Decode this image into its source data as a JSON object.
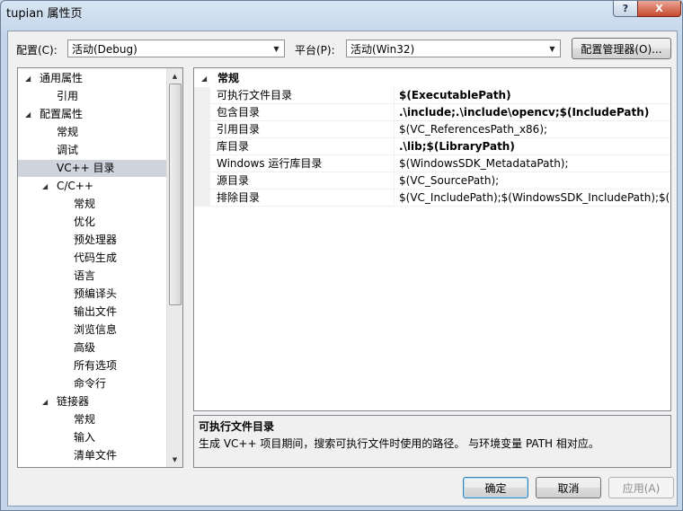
{
  "window": {
    "title": "tupian 属性页",
    "help_label": "?",
    "close_label": "X"
  },
  "config": {
    "label": "配置(C):",
    "value": "活动(Debug)",
    "platform_label": "平台(P):",
    "platform_value": "活动(Win32)",
    "manager_button": "配置管理器(O)..."
  },
  "tree": {
    "items": [
      {
        "label": "通用属性",
        "level": 0,
        "expanded": true
      },
      {
        "label": "引用",
        "level": 1
      },
      {
        "label": "配置属性",
        "level": 0,
        "expanded": true
      },
      {
        "label": "常规",
        "level": 1
      },
      {
        "label": "调试",
        "level": 1
      },
      {
        "label": "VC++ 目录",
        "level": 1,
        "selected": true
      },
      {
        "label": "C/C++",
        "level": 1,
        "expanded": true
      },
      {
        "label": "常规",
        "level": 2
      },
      {
        "label": "优化",
        "level": 2
      },
      {
        "label": "预处理器",
        "level": 2
      },
      {
        "label": "代码生成",
        "level": 2
      },
      {
        "label": "语言",
        "level": 2
      },
      {
        "label": "预编译头",
        "level": 2
      },
      {
        "label": "输出文件",
        "level": 2
      },
      {
        "label": "浏览信息",
        "level": 2
      },
      {
        "label": "高级",
        "level": 2
      },
      {
        "label": "所有选项",
        "level": 2
      },
      {
        "label": "命令行",
        "level": 2
      },
      {
        "label": "链接器",
        "level": 1,
        "expanded": true
      },
      {
        "label": "常规",
        "level": 2
      },
      {
        "label": "输入",
        "level": 2
      },
      {
        "label": "清单文件",
        "level": 2
      }
    ]
  },
  "grid": {
    "category": "常规",
    "rows": [
      {
        "name": "可执行文件目录",
        "value": "$(ExecutablePath)",
        "bold": true
      },
      {
        "name": "包含目录",
        "value": ".\\include;.\\include\\opencv;$(IncludePath)",
        "bold": true
      },
      {
        "name": "引用目录",
        "value": "$(VC_ReferencesPath_x86);",
        "bold": false
      },
      {
        "name": "库目录",
        "value": ".\\lib;$(LibraryPath)",
        "bold": true
      },
      {
        "name": "Windows 运行库目录",
        "value": "$(WindowsSDK_MetadataPath);",
        "bold": false
      },
      {
        "name": "源目录",
        "value": "$(VC_SourcePath);",
        "bold": false
      },
      {
        "name": "排除目录",
        "value": "$(VC_IncludePath);$(WindowsSDK_IncludePath);$(MS",
        "bold": false
      }
    ]
  },
  "description": {
    "title": "可执行文件目录",
    "text": "生成 VC++ 项目期间，搜索可执行文件时使用的路径。 与环境变量 PATH 相对应。"
  },
  "buttons": {
    "ok": "确定",
    "cancel": "取消",
    "apply": "应用(A)"
  },
  "icons": {
    "expanded": "triangle-down-icon",
    "scroll_up": "scroll-up-arrow-icon",
    "scroll_down": "scroll-down-arrow-icon",
    "dropdown": "chevron-down-icon"
  }
}
